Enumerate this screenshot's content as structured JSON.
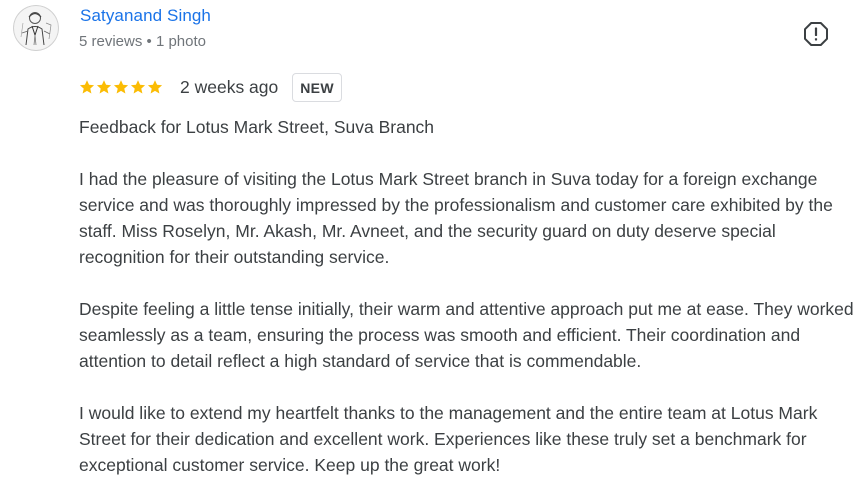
{
  "reviewer": {
    "name": "Satyanand Singh",
    "meta": "5 reviews • 1 photo",
    "avatar_icon": "profile-photo-sketch"
  },
  "report_icon": "report-exclamation-icon",
  "rating": {
    "stars": 5,
    "max_stars": 5,
    "star_color": "#fbbc04",
    "time_ago": "2 weeks ago",
    "badge": "NEW"
  },
  "review": {
    "title": "Feedback for Lotus Mark Street, Suva Branch",
    "paragraphs": [
      "I had the pleasure of visiting the Lotus Mark Street branch in Suva today for a foreign exchange service and was thoroughly impressed by the professionalism and customer care exhibited by the staff. Miss Roselyn, Mr. Akash, Mr. Avneet, and the security guard on duty deserve special recognition for their outstanding service.",
      "Despite feeling a little tense initially, their warm and attentive approach put me at ease. They worked seamlessly as a team, ensuring the process was smooth and efficient. Their coordination and attention to detail reflect a high standard of service that is commendable.",
      "I would like to extend my heartfelt thanks to the management and the entire team at Lotus Mark Street for their dedication and excellent work. Experiences like these truly set a benchmark for exceptional customer service. Keep up the great work!"
    ]
  },
  "colors": {
    "name_link": "#1a73e8",
    "meta_text": "#70757a",
    "body_text": "#3c4043",
    "badge_border": "#dadce0"
  }
}
